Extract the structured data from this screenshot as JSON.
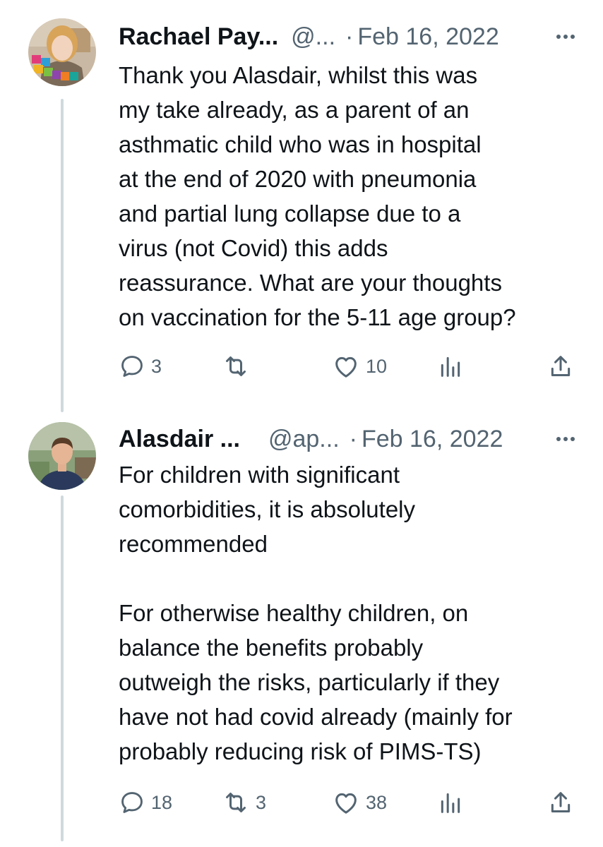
{
  "tweets": [
    {
      "author_name": "Rachael Pay...",
      "handle": "@...",
      "separator": "·",
      "date": "Feb 16, 2022",
      "avatar_icon": "profile-photo-we-are-uhs",
      "text": "Thank you Alasdair, whilst this was\nmy take already, as a parent of an\nasthmatic child who was in hospital\nat the end of 2020 with pneumonia\nand partial lung collapse due to a\nvirus (not Covid) this adds\nreassurance. What are your thoughts\non vaccination for the 5-11 age group?",
      "actions": {
        "replies": "3",
        "reposts": "",
        "likes": "10"
      }
    },
    {
      "author_name": "Alasdair ...",
      "handle": "@ap...",
      "separator": "·",
      "date": "Feb 16, 2022",
      "avatar_icon": "profile-photo-man",
      "text": "For children with significant\ncomorbidities, it is absolutely\nrecommended\n\nFor otherwise healthy children, on\nbalance the benefits probably\noutweigh the risks, particularly if they\nhave not had covid already (mainly for\nprobably reducing risk of PIMS-TS)",
      "actions": {
        "replies": "18",
        "reposts": "3",
        "likes": "38"
      }
    }
  ],
  "icons": {
    "reply": "speech-bubble-icon",
    "repost": "repost-arrows-icon",
    "like": "heart-icon",
    "views": "bar-chart-icon",
    "share": "share-upload-icon",
    "more": "more-dots-icon"
  },
  "colors": {
    "text": "#0f1419",
    "secondary": "#536471",
    "thread_line": "#cfd9de"
  }
}
